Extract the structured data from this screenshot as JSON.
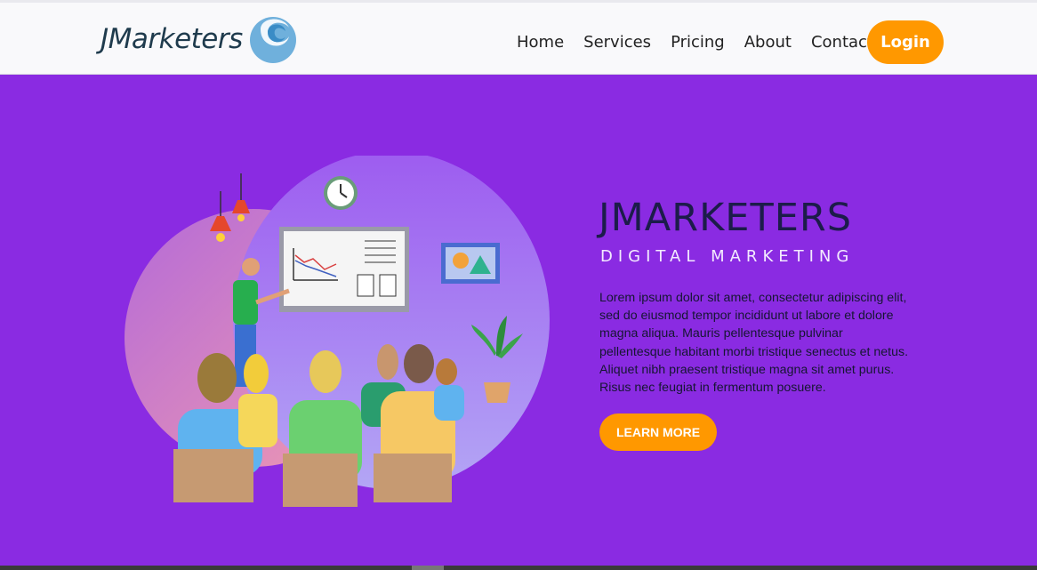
{
  "brand": {
    "name": "JMarketers"
  },
  "nav": {
    "items": [
      "Home",
      "Services",
      "Pricing",
      "About",
      "Contact Us"
    ],
    "login_label": "Login"
  },
  "hero": {
    "title": "JMARKETERS",
    "subtitle": "DIGITAL MARKETING",
    "paragraph": "Lorem ipsum dolor sit amet, consectetur adipiscing elit, sed do eiusmod tempor incididunt ut labore et dolore magna aliqua. Mauris pellentesque pulvinar pellentesque habitant morbi tristique senectus et netus. Aliquet nibh praesent tristique magna sit amet purus. Risus nec feugiat in fermentum posuere.",
    "cta_label": "LEARN MORE"
  },
  "icons": [
    "logo-wave-icon",
    "presentation-illustration"
  ],
  "colors": {
    "background": "#8a2be2",
    "accent": "#ff9800",
    "title": "#1c1c4a",
    "header": "#f9f9fb"
  }
}
